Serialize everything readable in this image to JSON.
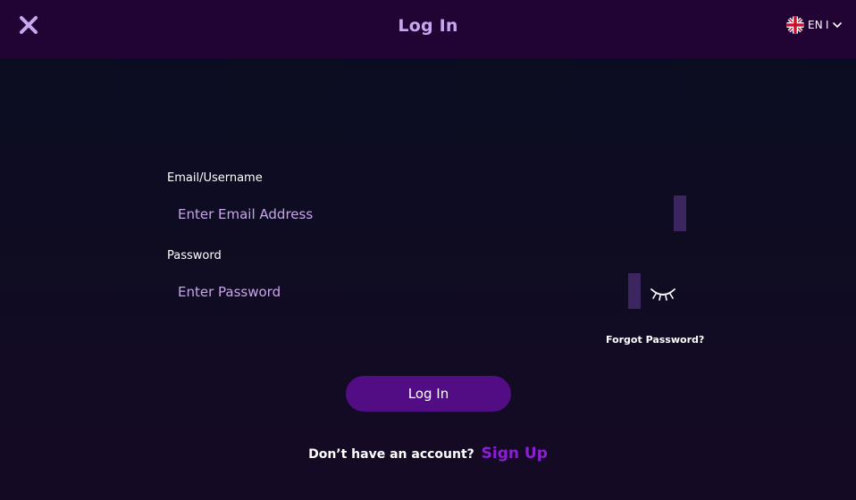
{
  "header": {
    "title": "Log In",
    "close_icon": "close-x-icon",
    "language": {
      "code": "EN",
      "separator": "I",
      "flag_icon": "uk-flag-icon",
      "chevron_icon": "chevron-down-icon"
    }
  },
  "form": {
    "email": {
      "label": "Email/Username",
      "placeholder": "Enter Email Address",
      "value": ""
    },
    "password": {
      "label": "Password",
      "placeholder": "Enter Password",
      "value": "",
      "toggle_icon": "eye-closed-icon"
    },
    "forgot_password": "Forgot Password?",
    "submit_label": "Log In"
  },
  "footer": {
    "prompt": "Don’t have an account?",
    "signup_label": "Sign Up"
  },
  "colors": {
    "header_bg": "#210334",
    "title": "#c9a7ef",
    "accent": "#520d85",
    "link": "#8c1fd6",
    "placeholder": "#c7a6e8"
  }
}
